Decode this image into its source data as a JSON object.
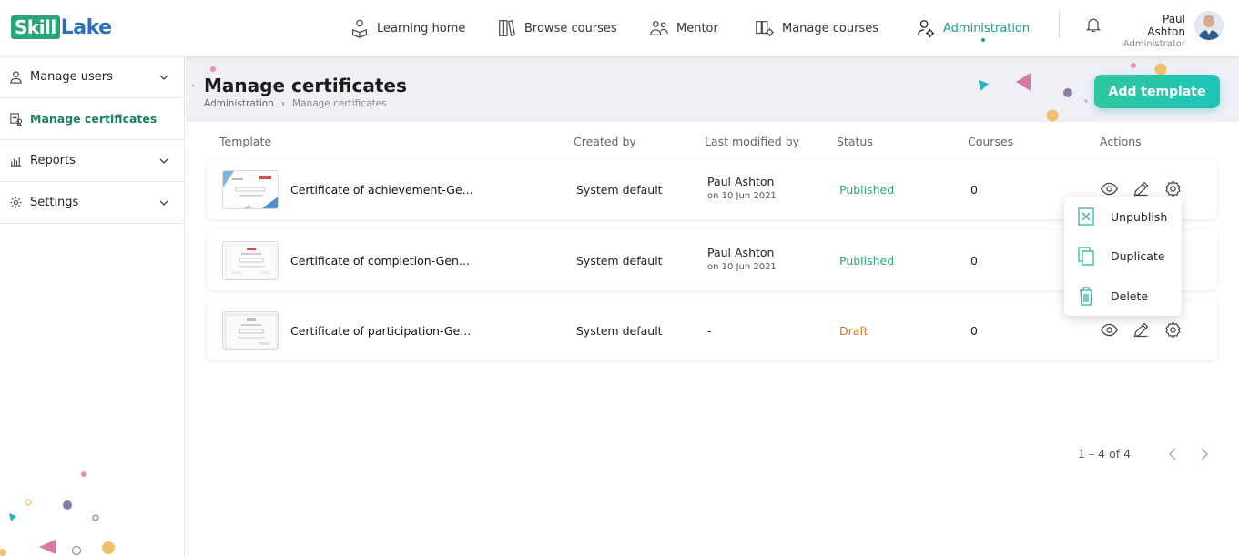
{
  "app": {
    "logo_part1": "Skill",
    "logo_part2": "Lake"
  },
  "nav": {
    "items": [
      {
        "label": "Learning home",
        "icon": "learning-home-icon"
      },
      {
        "label": "Browse courses",
        "icon": "books-icon"
      },
      {
        "label": "Mentor",
        "icon": "mentor-icon"
      },
      {
        "label": "Manage courses",
        "icon": "manage-courses-icon"
      },
      {
        "label": "Administration",
        "icon": "admin-icon",
        "active": true
      }
    ]
  },
  "user": {
    "name": "Paul Ashton",
    "role": "Administrator"
  },
  "sidebar": {
    "items": [
      {
        "label": "Manage users",
        "icon": "user-icon",
        "expandable": true
      },
      {
        "label": "Manage certificates",
        "icon": "certificate-icon",
        "active": true
      },
      {
        "label": "Reports",
        "icon": "reports-icon",
        "expandable": true
      },
      {
        "label": "Settings",
        "icon": "gear-icon",
        "expandable": true
      }
    ]
  },
  "page": {
    "title": "Manage certificates",
    "breadcrumb": [
      "Administration",
      "Manage certificates"
    ],
    "add_button": "Add template"
  },
  "table": {
    "headers": [
      "Template",
      "Created by",
      "Last modified by",
      "Status",
      "Courses",
      "Actions"
    ],
    "rows": [
      {
        "name": "Certificate of achievement-Ge...",
        "created_by": "System default",
        "modified_by": "Paul Ashton",
        "modified_on": "on 10 Jun 2021",
        "status": "Published",
        "courses": "0"
      },
      {
        "name": "Certificate of completion-Gen...",
        "created_by": "System default",
        "modified_by": "Paul Ashton",
        "modified_on": "on 10 Jun 2021",
        "status": "Published",
        "courses": "0"
      },
      {
        "name": "Certificate of participation-Ge...",
        "created_by": "System default",
        "modified_by": "-",
        "modified_on": "",
        "status": "Draft",
        "courses": "0"
      }
    ]
  },
  "context_menu": {
    "items": [
      {
        "label": "Unpublish",
        "icon": "unpublish-icon"
      },
      {
        "label": "Duplicate",
        "icon": "duplicate-icon"
      },
      {
        "label": "Delete",
        "icon": "trash-icon"
      }
    ]
  },
  "pagination": {
    "range": "1 – 4 of 4"
  },
  "colors": {
    "accent": "#1ba083",
    "published": "#2eaa7e",
    "draft": "#c8782a"
  }
}
